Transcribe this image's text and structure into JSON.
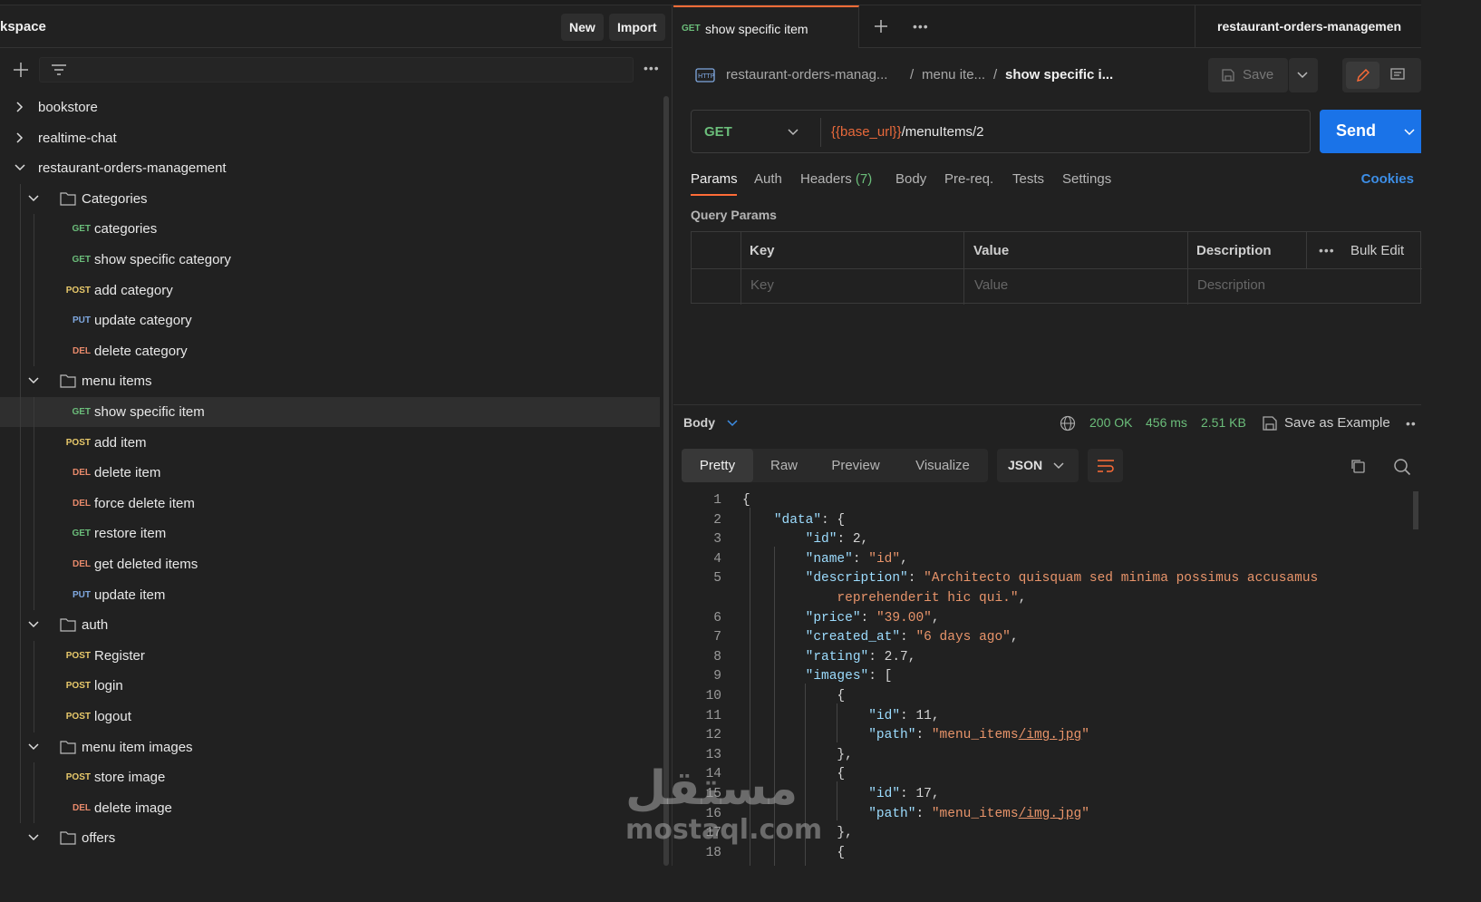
{
  "workspace": {
    "title": "kspace",
    "new_label": "New",
    "import_label": "Import"
  },
  "tree": [
    {
      "type": "collection",
      "label": "bookstore",
      "expanded": false
    },
    {
      "type": "collection",
      "label": "realtime-chat",
      "expanded": false
    },
    {
      "type": "collection",
      "label": "restaurant-orders-management",
      "expanded": true
    },
    {
      "type": "folder",
      "label": "Categories"
    },
    {
      "type": "request",
      "method": "GET",
      "label": "categories"
    },
    {
      "type": "request",
      "method": "GET",
      "label": "show specific category"
    },
    {
      "type": "request",
      "method": "POST",
      "label": "add category"
    },
    {
      "type": "request",
      "method": "PUT",
      "label": "update category"
    },
    {
      "type": "request",
      "method": "DEL",
      "label": "delete category"
    },
    {
      "type": "folder",
      "label": "menu items"
    },
    {
      "type": "request",
      "method": "GET",
      "label": "show specific item",
      "active": true
    },
    {
      "type": "request",
      "method": "POST",
      "label": "add item"
    },
    {
      "type": "request",
      "method": "DEL",
      "label": "delete item"
    },
    {
      "type": "request",
      "method": "DEL",
      "label": "force delete item"
    },
    {
      "type": "request",
      "method": "GET",
      "label": "restore item"
    },
    {
      "type": "request",
      "method": "DEL",
      "label": "get deleted items"
    },
    {
      "type": "request",
      "method": "PUT",
      "label": "update item"
    },
    {
      "type": "folder",
      "label": "auth"
    },
    {
      "type": "request",
      "method": "POST",
      "label": "Register"
    },
    {
      "type": "request",
      "method": "POST",
      "label": "login"
    },
    {
      "type": "request",
      "method": "POST",
      "label": "logout"
    },
    {
      "type": "folder",
      "label": "menu item images"
    },
    {
      "type": "request",
      "method": "POST",
      "label": "store image"
    },
    {
      "type": "request",
      "method": "DEL",
      "label": "delete image"
    },
    {
      "type": "folder",
      "label": "offers"
    }
  ],
  "tab": {
    "method": "GET",
    "title": "show specific item"
  },
  "environment": "restaurant-orders-managemen",
  "breadcrumb": {
    "collection": "restaurant-orders-manag...",
    "folder": "menu ite...",
    "current": "show specific i..."
  },
  "save_label": "Save",
  "request": {
    "method": "GET",
    "url_var": "{{base_url}}",
    "url_path": "/menuItems/2"
  },
  "send_label": "Send",
  "request_tabs": {
    "params": "Params",
    "auth": "Auth",
    "headers": "Headers",
    "headers_count": "(7)",
    "body": "Body",
    "prereq": "Pre-req.",
    "tests": "Tests",
    "settings": "Settings",
    "cookies": "Cookies"
  },
  "query_params": {
    "title": "Query Params",
    "headers": {
      "key": "Key",
      "value": "Value",
      "description": "Description",
      "bulk": "Bulk Edit"
    },
    "placeholders": {
      "key": "Key",
      "value": "Value",
      "description": "Description"
    }
  },
  "response": {
    "body_label": "Body",
    "status": "200 OK",
    "time": "456 ms",
    "size": "2.51 KB",
    "save_example": "Save as Example",
    "views": [
      "Pretty",
      "Raw",
      "Preview",
      "Visualize"
    ],
    "format": "JSON"
  },
  "code_lines": [
    {
      "n": "1",
      "text": "{"
    },
    {
      "n": "2",
      "text": "    \"data\": {"
    },
    {
      "n": "3",
      "text": "        \"id\": 2,"
    },
    {
      "n": "4",
      "text": "        \"name\": \"id\","
    },
    {
      "n": "5",
      "text": "        \"description\": \"Architecto quisquam sed minima possimus accusamus"
    },
    {
      "n": "",
      "text": "            reprehenderit hic qui.\","
    },
    {
      "n": "6",
      "text": "        \"price\": \"39.00\","
    },
    {
      "n": "7",
      "text": "        \"created_at\": \"6 days ago\","
    },
    {
      "n": "8",
      "text": "        \"rating\": 2.7,"
    },
    {
      "n": "9",
      "text": "        \"images\": ["
    },
    {
      "n": "10",
      "text": "            {"
    },
    {
      "n": "11",
      "text": "                \"id\": 11,"
    },
    {
      "n": "12",
      "text": "                \"path\": \"menu_items/img.jpg\""
    },
    {
      "n": "13",
      "text": "            },"
    },
    {
      "n": "14",
      "text": "            {"
    },
    {
      "n": "15",
      "text": "                \"id\": 17,"
    },
    {
      "n": "16",
      "text": "                \"path\": \"menu_items/img.jpg\""
    },
    {
      "n": "17",
      "text": "            },"
    },
    {
      "n": "18",
      "text": "            {"
    }
  ],
  "watermark": {
    "arabic": "مستقل",
    "latin": "mostaql.com"
  },
  "colors": {
    "accent": "#ff6c37",
    "send": "#1a73e8",
    "get": "#6bbd7a",
    "post": "#e8c96b",
    "put": "#7fa8e0",
    "del": "#e88a6b"
  }
}
